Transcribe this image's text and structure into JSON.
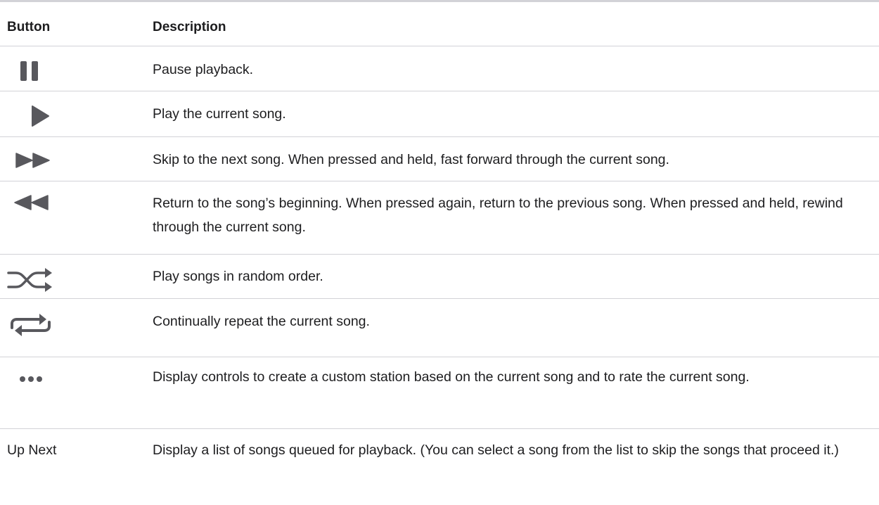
{
  "table": {
    "headers": {
      "button": "Button",
      "description": "Description"
    },
    "rows": [
      {
        "icon": "pause-icon",
        "button_label": "",
        "description": "Pause playback."
      },
      {
        "icon": "play-icon",
        "button_label": "",
        "description": "Play the current song."
      },
      {
        "icon": "fast-forward-icon",
        "button_label": "",
        "description": "Skip to the next song. When pressed and held, fast forward through the current song."
      },
      {
        "icon": "rewind-icon",
        "button_label": "",
        "description": "Return to the song’s beginning. When pressed again, return to the previous song. When pressed and held, rewind through the current song."
      },
      {
        "icon": "shuffle-icon",
        "button_label": "",
        "description": "Play songs in random order."
      },
      {
        "icon": "repeat-icon",
        "button_label": "",
        "description": "Continually repeat the current song."
      },
      {
        "icon": "more-icon",
        "button_label": "",
        "description": "Display controls to create a custom station based on the current song and to rate the current song."
      },
      {
        "icon": "",
        "button_label": "Up Next",
        "description": "Display a list of songs queued for playback. (You can select a song from the list to skip the songs that proceed it.)"
      }
    ]
  },
  "colors": {
    "text": "#1d1d1f",
    "icon": "#58585d",
    "rule": "#d2d2d7"
  }
}
